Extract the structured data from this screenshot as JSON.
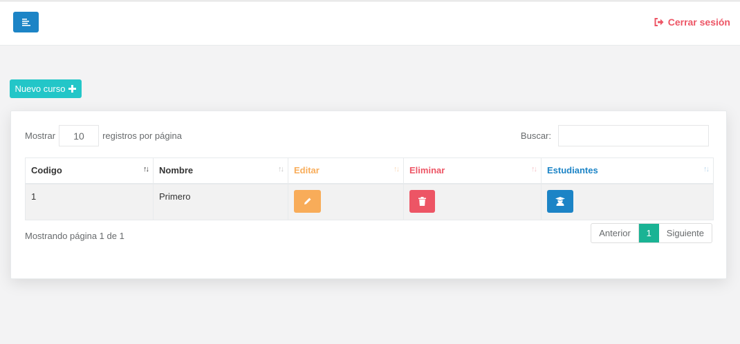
{
  "colors": {
    "primary": "#1c84c6",
    "info": "#23c6c8",
    "warning": "#f8ac59",
    "danger": "#ed5565",
    "success": "#1ab394"
  },
  "topbar": {
    "menu_icon": "align-left-icon",
    "logout_label": "Cerrar sesión",
    "logout_icon": "sign-out-icon"
  },
  "new_course": {
    "label": "Nuevo curso",
    "icon": "plus-icon"
  },
  "table_controls": {
    "show_label": "Mostrar",
    "page_size": "10",
    "per_page_label": "registros por página",
    "search_label": "Buscar:",
    "search_value": ""
  },
  "table": {
    "columns": [
      "Codigo",
      "Nombre",
      "Editar",
      "Eliminar",
      "Estudiantes"
    ],
    "rows": [
      {
        "codigo": "1",
        "nombre": "Primero"
      }
    ]
  },
  "footer": {
    "info": "Mostrando página 1 de 1",
    "prev": "Anterior",
    "current_page": "1",
    "next": "Siguiente"
  }
}
